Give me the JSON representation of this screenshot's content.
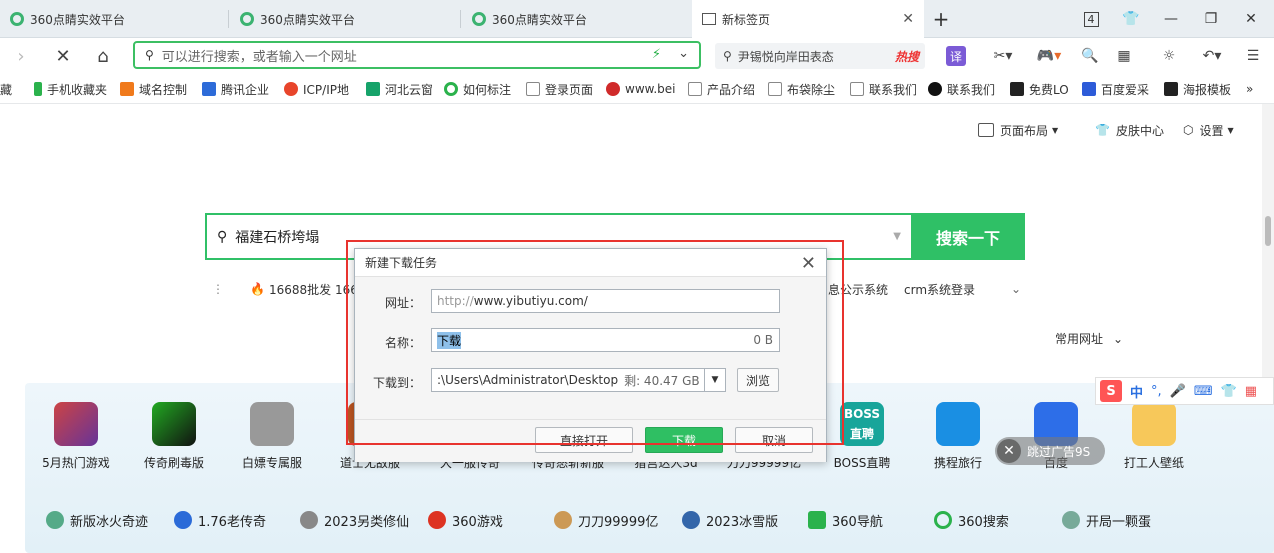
{
  "tabs": [
    {
      "title": "360点睛实效平台"
    },
    {
      "title": "360点睛实效平台"
    },
    {
      "title": "360点睛实效平台"
    },
    {
      "title": "新标签页"
    }
  ],
  "tabbar_right": {
    "tab_count": "4"
  },
  "address": {
    "placeholder": "可以进行搜索，或者输入一个网址"
  },
  "side_search": {
    "text": "尹锡悦向岸田表态",
    "hot": "热搜"
  },
  "toolbar_ext": {
    "translate": "译"
  },
  "bookmarks": [
    "藏",
    "手机收藏夹",
    "域名控制",
    "腾讯企业",
    "ICP/IP地",
    "河北云窗",
    "如何标注",
    "登录页面",
    "www.bei",
    "产品介绍",
    "布袋除尘",
    "联系我们",
    "联系我们",
    "免费LO",
    "百度爱采",
    "海报模板"
  ],
  "bookmarks_more": "»",
  "page_top": {
    "layout": "页面布局",
    "skin": "皮肤中心",
    "settings": "设置"
  },
  "main_search": {
    "value": "福建石桥垮塌",
    "button": "搜索一下"
  },
  "hot_row": {
    "left": "16688批发 166",
    "right1": "息公示系统",
    "right2": "crm系统登录"
  },
  "common_sites": "常用网址",
  "apps": [
    "5月热门游戏",
    "传奇刷毒版",
    "白嫖专属服",
    "道士无敌服",
    "大一服传奇",
    "传奇怒斩新服",
    "猎宫达人3d",
    "刀刀99999亿",
    "BOSS直聘",
    "携程旅行",
    "百度",
    "打工人壁纸"
  ],
  "bottom_row": [
    "新版冰火奇迹",
    "1.76老传奇",
    "2023另类修仙",
    "360游戏",
    "刀刀99999亿",
    "2023冰雪版",
    "360导航",
    "360搜索",
    "开局一颗蛋"
  ],
  "skip_ad": "跳过广告9S",
  "ime": {
    "zh": "中"
  },
  "dialog": {
    "title": "新建下载任务",
    "url_label": "网址：",
    "url_prefix": "http://",
    "url_host": "www.yibutiyu.com/",
    "name_label": "名称：",
    "name_value": "下载",
    "name_size": "0 B",
    "saveto_label": "下载到：",
    "saveto_path": ":\\Users\\Administrator\\Desktop",
    "saveto_free": "剩: 40.47 GB",
    "browse": "浏览",
    "open_direct": "直接打开",
    "download": "下载",
    "cancel": "取消"
  }
}
